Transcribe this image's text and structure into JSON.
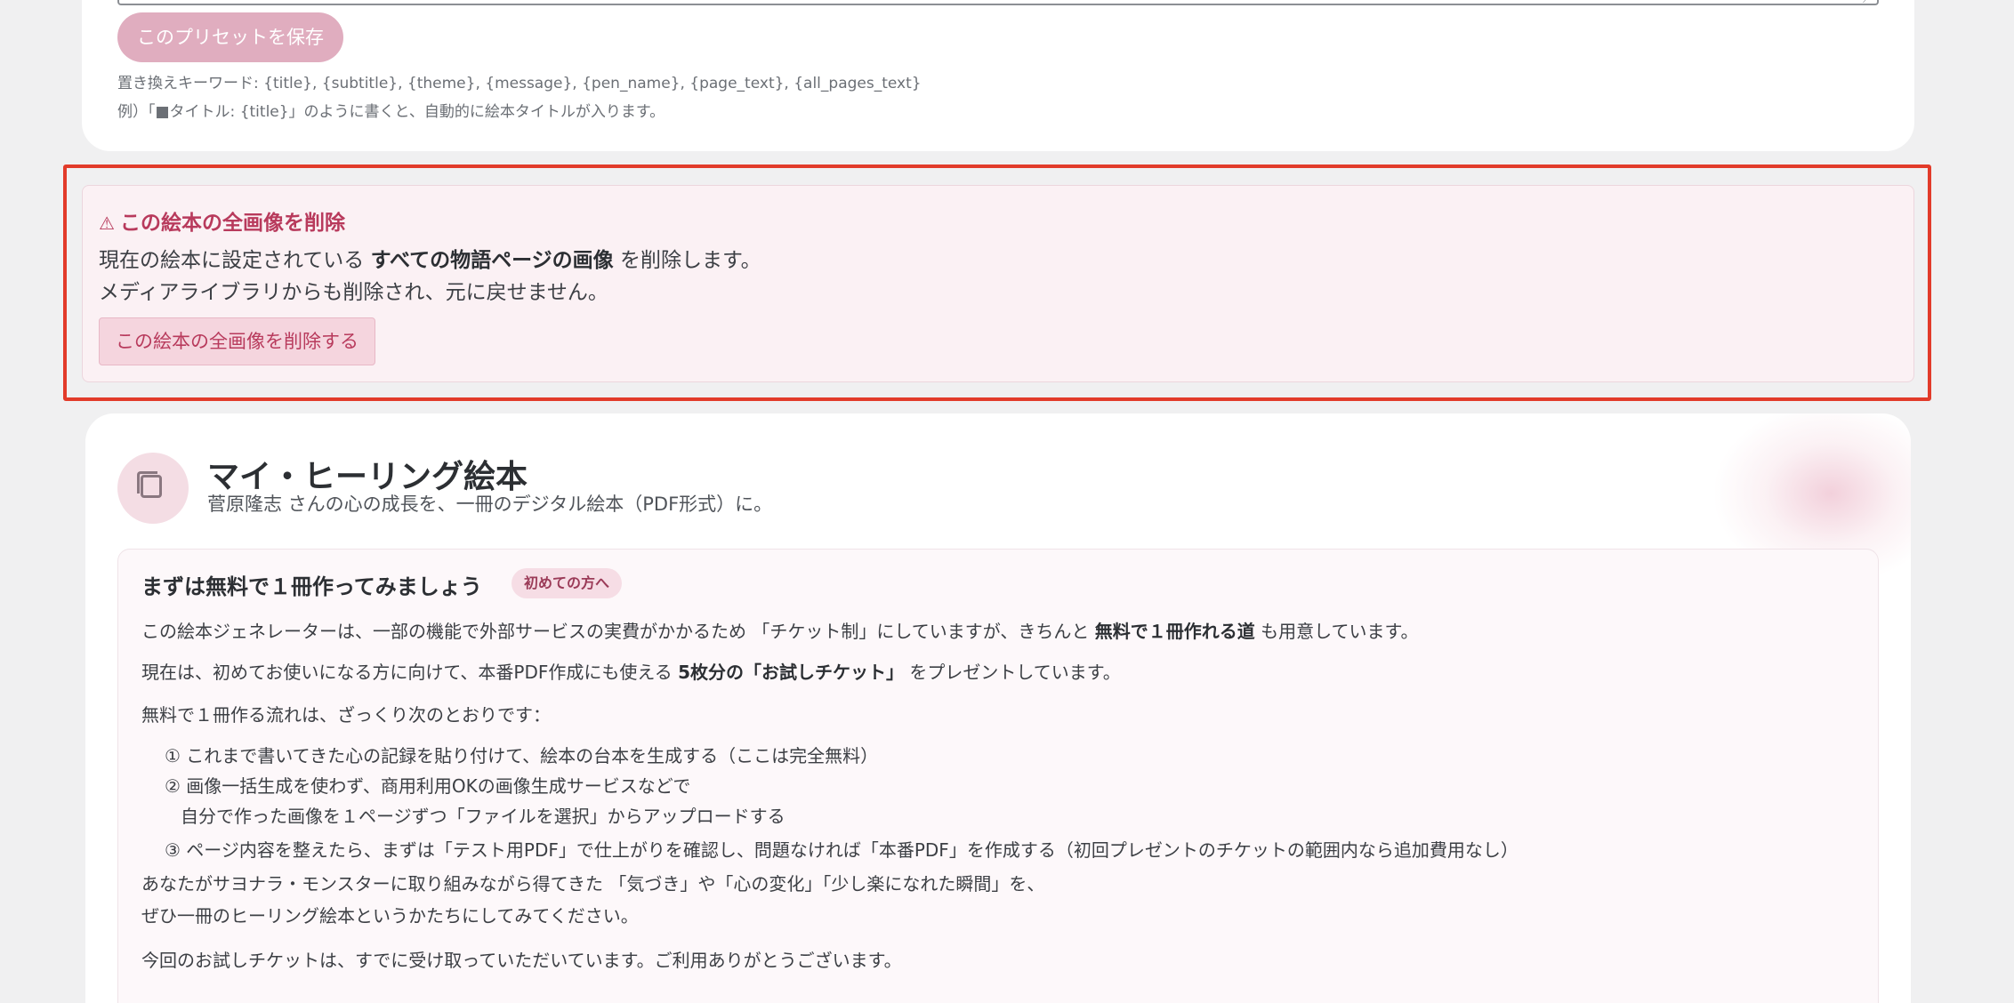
{
  "preset": {
    "save_button": "このプリセットを保存",
    "keywords": "置き換えキーワード: {title}, {subtitle}, {theme}, {message}, {pen_name}, {page_text}, {all_pages_text}",
    "example": "例）「■タイトル: {title}」のように書くと、自動的に絵本タイトルが入ります。"
  },
  "danger": {
    "icon": "⚠",
    "title": "この絵本の全画像を削除",
    "desc_line1_pre": "現在の絵本に設定されている",
    "desc_line1_bold": "すべての物語ページの画像",
    "desc_line1_post": "を削除します。",
    "desc_line2": "メディアライブラリからも削除され、元に戻せません。",
    "button": "この絵本の全画像を削除する",
    "colors": {
      "outline": "#e23b2a",
      "accent": "#b83a5c"
    }
  },
  "book": {
    "title": "マイ・ヒーリング絵本",
    "subtitle": "菅原隆志 さんの心の成長を、一冊のデジタル絵本（PDF形式）に。",
    "icon": "book-copy-icon",
    "intro": {
      "heading": "まずは無料で１冊作ってみましょう",
      "badge": "初めての方へ",
      "p1_pre": "この絵本ジェネレーターは、一部の機能で外部サービスの実費がかかるため 「チケット制」にしていますが、きちんと",
      "p1_bold": "無料で１冊作れる道",
      "p1_post": "も用意しています。",
      "p2_pre": "現在は、初めてお使いになる方に向けて、本番PDF作成にも使える",
      "p2_bold": "5枚分の「お試しチケット」",
      "p2_post": "をプレゼントしています。",
      "p3": "無料で１冊作る流れは、ざっくり次のとおりです：",
      "step1": "① これまで書いてきた心の記録を貼り付けて、絵本の台本を生成する（ここは完全無料）",
      "step2a": "② 画像一括生成を使わず、商用利用OKの画像生成サービスなどで",
      "step2b": "自分で作った画像を１ページずつ「ファイルを選択」からアップロードする",
      "step3": "③ ページ内容を整えたら、まずは「テスト用PDF」で仕上がりを確認し、問題なければ「本番PDF」を作成する（初回プレゼントのチケットの範囲内なら追加費用なし）",
      "p4a": "あなたがサヨナラ・モンスターに取り組みながら得てきた 「気づき」や「心の変化」「少し楽になれた瞬間」を、",
      "p4b": "ぜひ一冊のヒーリング絵本というかたちにしてみてください。",
      "p5": "今回のお試しチケットは、すでに受け取っていただいています。ご利用ありがとうございます。"
    }
  }
}
